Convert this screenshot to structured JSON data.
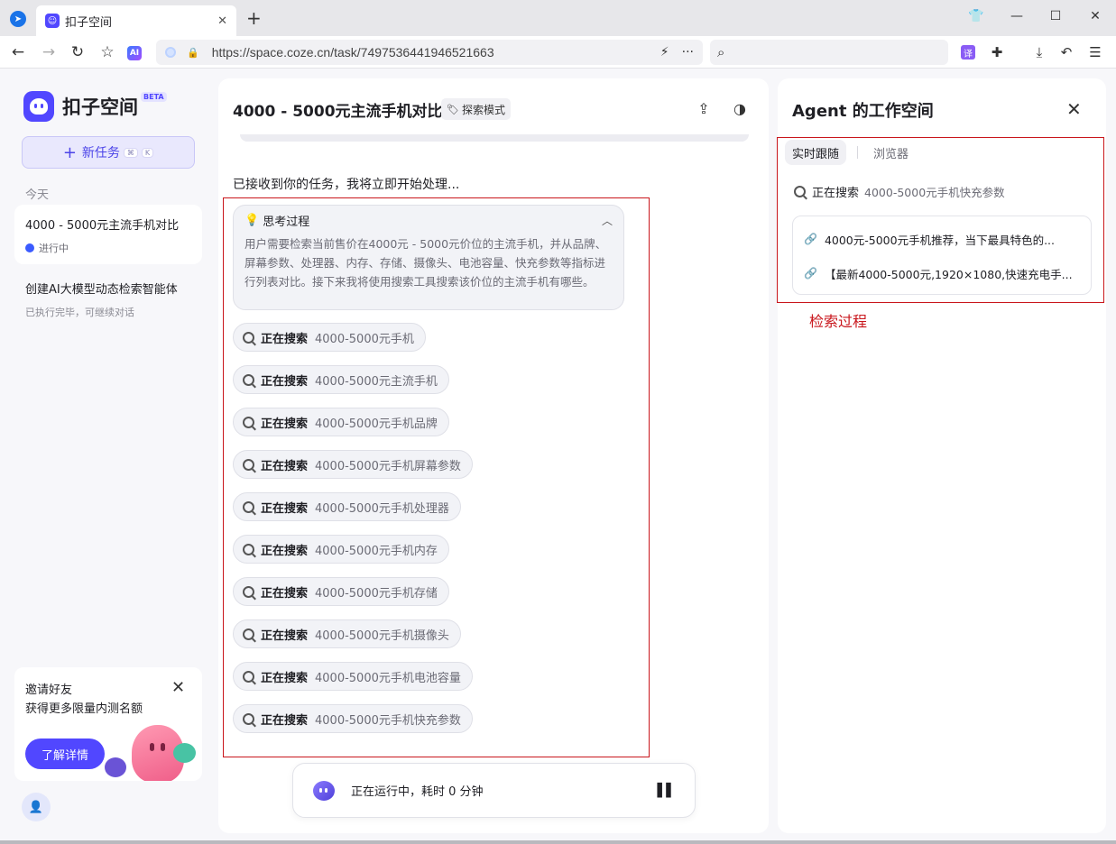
{
  "browser": {
    "tab_title": "扣子空间",
    "url": "https://space.coze.cn/task/7497536441946521663",
    "icons": [
      "browser-logo-icon",
      "back-icon",
      "forward-icon",
      "reload-icon",
      "bookmark-icon",
      "ai-icon",
      "lock-icon",
      "bolt-icon",
      "more-icon",
      "search-icon",
      "translate-icon",
      "extension-icon",
      "download-icon",
      "undo-icon",
      "menu-icon"
    ]
  },
  "sidebar": {
    "brand": "扣子空间",
    "beta": "BETA",
    "new_task": "新任务",
    "shortcut_mod": "⌘",
    "shortcut_key": "K",
    "section_today": "今天",
    "tasks": [
      {
        "title": "4000 - 5000元主流手机对比",
        "status": "进行中"
      },
      {
        "title": "创建AI大模型动态检索智能体",
        "status": "已执行完毕，可继续对话"
      }
    ],
    "invite": {
      "title": "邀请好友",
      "subtitle": "获得更多限量内测名额",
      "button": "了解详情"
    }
  },
  "main": {
    "title": "4000 - 5000元主流手机对比",
    "mode": "探索模式",
    "received": "已接收到你的任务，我将立即开始处理...",
    "thinking": {
      "label": "思考过程",
      "text": "用户需要检索当前售价在4000元 - 5000元价位的主流手机，并从品牌、屏幕参数、处理器、内存、存储、摄像头、电池容量、快充参数等指标进行列表对比。接下来我将使用搜索工具搜索该价位的主流手机有哪些。"
    },
    "searches": [
      {
        "label": "正在搜索",
        "query": "4000-5000元手机"
      },
      {
        "label": "正在搜索",
        "query": "4000-5000元主流手机"
      },
      {
        "label": "正在搜索",
        "query": "4000-5000元手机品牌"
      },
      {
        "label": "正在搜索",
        "query": "4000-5000元手机屏幕参数"
      },
      {
        "label": "正在搜索",
        "query": "4000-5000元手机处理器"
      },
      {
        "label": "正在搜索",
        "query": "4000-5000元手机内存"
      },
      {
        "label": "正在搜索",
        "query": "4000-5000元手机存储"
      },
      {
        "label": "正在搜索",
        "query": "4000-5000元手机摄像头"
      },
      {
        "label": "正在搜索",
        "query": "4000-5000元手机电池容量"
      },
      {
        "label": "正在搜索",
        "query": "4000-5000元手机快充参数"
      }
    ],
    "running": "正在运行中，耗时 0 分钟"
  },
  "workspace": {
    "title": "Agent 的工作空间",
    "tabs": [
      "实时跟随",
      "浏览器"
    ],
    "search_label": "正在搜索",
    "search_query": "4000-5000元手机快充参数",
    "results": [
      "4000元-5000元手机推荐，当下最具特色的...",
      "【最新4000-5000元,1920×1080,快速充电手..."
    ]
  },
  "annotation": {
    "label": "检索过程",
    "color": "#c9161c"
  }
}
